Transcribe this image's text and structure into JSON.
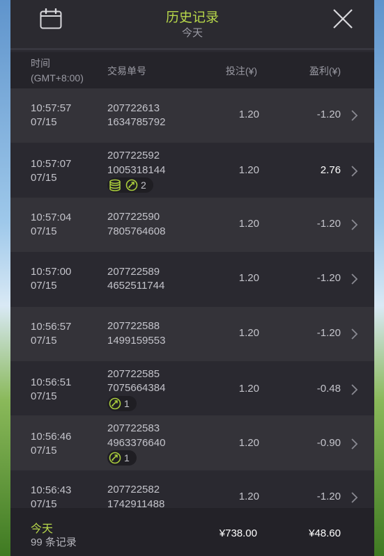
{
  "header": {
    "title": "历史记录",
    "subtitle": "今天"
  },
  "columns": {
    "time_line1": "时间",
    "time_line2": "(GMT+8:00)",
    "order": "交易单号",
    "bet": "投注(¥)",
    "profit": "盈利(¥)"
  },
  "rows": [
    {
      "time": "10:57:57",
      "date": "07/15",
      "order1": "207722613",
      "order2": "1634785792",
      "bet": "1.20",
      "profit": "-1.20"
    },
    {
      "time": "10:57:07",
      "date": "07/15",
      "order1": "207722592",
      "order2": "1005318144",
      "bet": "1.20",
      "profit": "2.76",
      "badge": {
        "coins": true,
        "count": "2"
      }
    },
    {
      "time": "10:57:04",
      "date": "07/15",
      "order1": "207722590",
      "order2": "7805764608",
      "bet": "1.20",
      "profit": "-1.20"
    },
    {
      "time": "10:57:00",
      "date": "07/15",
      "order1": "207722589",
      "order2": "4652511744",
      "bet": "1.20",
      "profit": "-1.20"
    },
    {
      "time": "10:56:57",
      "date": "07/15",
      "order1": "207722588",
      "order2": "1499159553",
      "bet": "1.20",
      "profit": "-1.20"
    },
    {
      "time": "10:56:51",
      "date": "07/15",
      "order1": "207722585",
      "order2": "7075664384",
      "bet": "1.20",
      "profit": "-0.48",
      "badge": {
        "coins": false,
        "count": "1"
      }
    },
    {
      "time": "10:56:46",
      "date": "07/15",
      "order1": "207722583",
      "order2": "4963376640",
      "bet": "1.20",
      "profit": "-0.90",
      "badge": {
        "coins": false,
        "count": "1"
      }
    },
    {
      "time": "10:56:43",
      "date": "07/15",
      "order1": "207722582",
      "order2": "1742911488",
      "bet": "1.20",
      "profit": "-1.20"
    }
  ],
  "footer": {
    "today": "今天",
    "count": "99 条记录",
    "bet_total": "¥738.00",
    "profit_total": "¥48.60"
  },
  "colors": {
    "accent": "#b8d84a",
    "panel": "#2a2930",
    "row_alt": "#343339"
  }
}
